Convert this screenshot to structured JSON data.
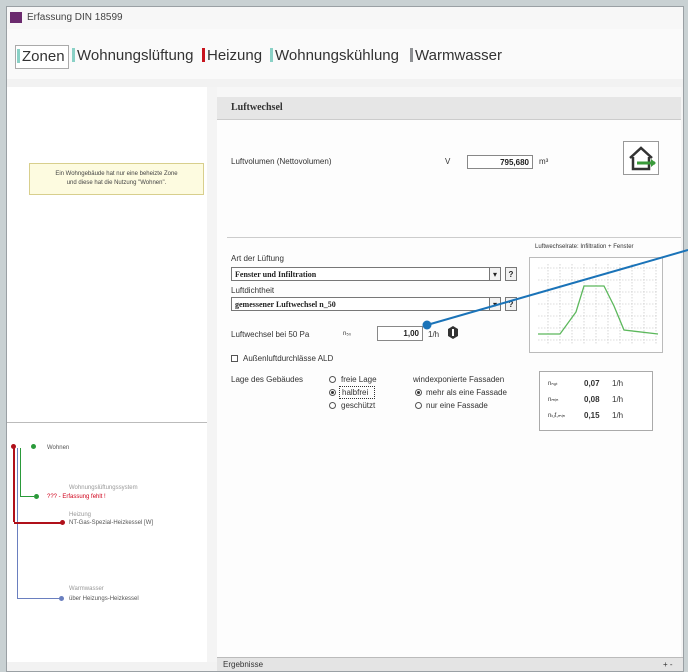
{
  "window": {
    "title": "Erfassung DIN 18599"
  },
  "tabs": [
    {
      "label": "Zonen"
    },
    {
      "label": "Wohnungslüftung"
    },
    {
      "label": "Heizung"
    },
    {
      "label": "Wohnungskühlung"
    },
    {
      "label": "Warmwasser"
    }
  ],
  "left_panel": {
    "info_line1": "Ein Wohngebäude hat nur eine beheizte Zone",
    "info_line2": "und diese hat die Nutzung \"Wohnen\".",
    "tree": {
      "root": "Wohnen",
      "vent_caption": "Wohnungslüftungssystem",
      "vent_value": "??? - Erfassung fehlt !",
      "heat_caption": "Heizung",
      "heat_value": "NT-Gas-Spezial-Heizkessel [W]",
      "water_caption": "Warmwasser",
      "water_value": "über Heizungs-Heizkessel"
    }
  },
  "section": {
    "title": "Luftwechsel"
  },
  "luftvolumen": {
    "label": "Luftvolumen  (Nettovolumen)",
    "symbol": "V",
    "value": "795,680",
    "unit": "m³"
  },
  "art_lueftung": {
    "label": "Art der Lüftung",
    "value": "Fenster und Infiltration",
    "help": "?"
  },
  "luftdichtheit": {
    "label": "Luftdichtheit",
    "value": "gemessener Luftwechsel n_50",
    "help": "?"
  },
  "lw50": {
    "label": "Luftwechsel bei 50 Pa",
    "symbol": "n₅₀",
    "value": "1,00",
    "unit": "1/h"
  },
  "ald": {
    "label": "Außenluftdurchlässe ALD"
  },
  "lage": {
    "label": "Lage des Gebäudes",
    "options": [
      "freie Lage",
      "halbfrei",
      "geschützt"
    ],
    "selected": "halbfrei"
  },
  "fassade": {
    "label": "windexponierte Fassaden",
    "options": [
      "mehr als eine Fassade",
      "nur eine Fassade"
    ],
    "selected": "mehr als eine Fassade"
  },
  "chart": {
    "title": "Luftwechselrate: Infiltration + Fenster"
  },
  "results": [
    {
      "symbol": "nₙₐₜ",
      "value": "0,07",
      "unit": "1/h"
    },
    {
      "symbol": "nₘᵢₙ",
      "value": "0,08",
      "unit": "1/h"
    },
    {
      "symbol": "nₗᵤf,ₘᵢₙ",
      "value": "0,15",
      "unit": "1/h"
    }
  ],
  "footer": {
    "label": "Ergebnisse",
    "control": "+ -"
  },
  "colors": {
    "accent": "#1a73b8",
    "tab_mark_teal": "#8ad1c6",
    "tab_mark_red": "#c8141e",
    "tree_red": "#b0101a",
    "warning": "#d0021b"
  }
}
